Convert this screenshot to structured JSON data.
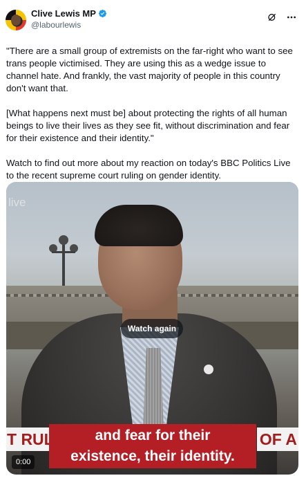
{
  "author": {
    "display_name": "Clive Lewis MP",
    "handle": "@labourlewis",
    "verified_icon": "verified-badge-icon",
    "accent": "#1d9bf0"
  },
  "header_icons": [
    "grok-icon",
    "more-icon"
  ],
  "tweet": {
    "paragraphs": [
      "\"There are a small group of extremists on the far-right who want to see trans people victimised. They are using this as a wedge issue to channel hate. And frankly, the vast majority of people in this country don't want that.",
      "[What happens next must be] about protecting the rights of all human beings to live their lives as they see fit, without discrimination and fear for their existence and their identity.\"",
      "Watch to find out more about my reaction on today's BBC Politics Live to the recent supreme court ruling on gender identity."
    ]
  },
  "video": {
    "channel_watermark": "live",
    "ticker_left": "T RUL",
    "ticker_right": "OF A",
    "subtitle_line1": "and fear for their",
    "subtitle_line2": "existence, their identity.",
    "watch_again_label": "Watch again",
    "timestamp": "0:00",
    "subtitle_bg": "#b41f26"
  }
}
